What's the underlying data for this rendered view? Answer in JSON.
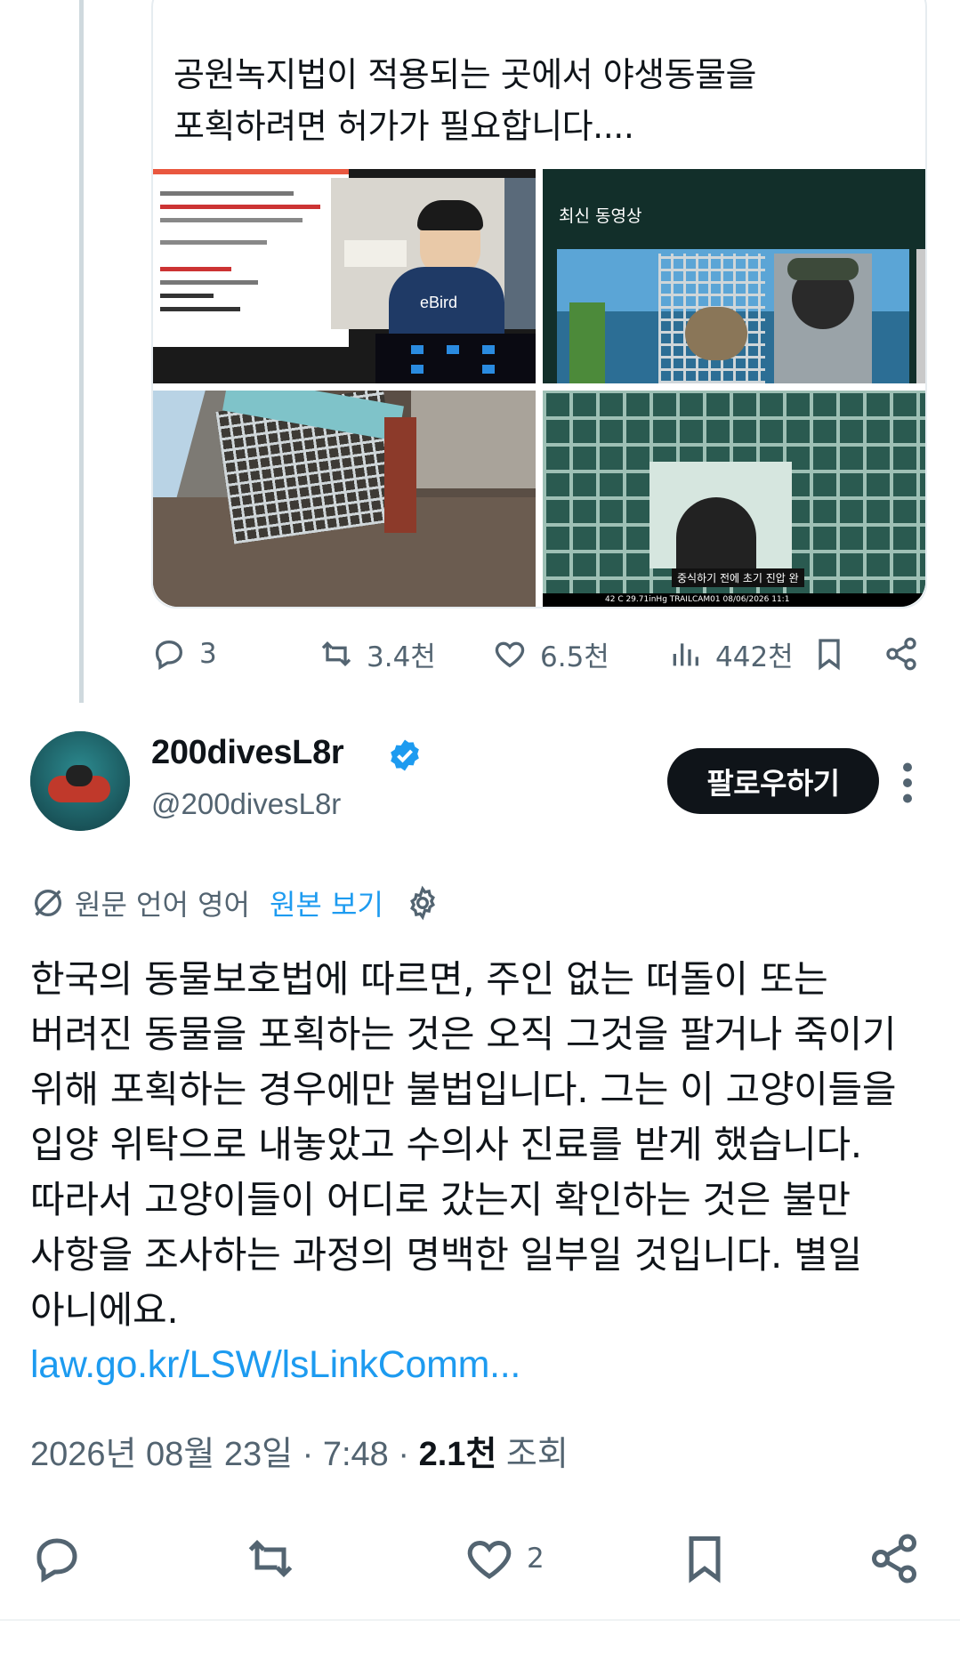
{
  "quoted": {
    "text_lines": [
      "공원녹지법이 적용되는 곳에서 야생동물을",
      "포획하려면 허가가 필요합니다...."
    ],
    "media": {
      "tile1_caption": "eBird",
      "tile2_title": "최신 동영상",
      "tile4_subtitle": "중식하기 전에 초기 진압 완",
      "tile4_info": "42 C  29.71inHg      TRAILCAM01      08/06/2026 11:1"
    },
    "actions": {
      "reply_count": "3",
      "retweet_count": "3.4천",
      "like_count": "6.5천",
      "views_count": "442천"
    }
  },
  "author": {
    "name": "200divesL8r",
    "handle": "@200divesL8r",
    "follow_label": "팔로우하기"
  },
  "translation": {
    "label": "원문 언어 영어",
    "view_original": "원본 보기"
  },
  "body": {
    "lines": [
      "한국의 동물보호법에 따르면, 주인 없는 떠돌이 또는",
      "버려진 동물을 포획하는 것은 오직 그것을 팔거나 죽이기",
      "위해 포획하는 경우에만 불법입니다. 그는 이 고양이들을",
      "입양 위탁으로 내놓았고 수의사 진료를 받게 했습니다.",
      "따라서 고양이들이 어디로 갔는지 확인하는 것은 불만",
      "사항을 조사하는 과정의 명백한 일부일 것입니다. 별일",
      "아니에요."
    ],
    "link": "law.go.kr/LSW/lsLinkComm..."
  },
  "meta": {
    "date": "2026년 08월 23일 · 7:48 · ",
    "views_number": "2.1천",
    "views_label": " 조회"
  },
  "bottom_actions": {
    "like_count": "2"
  },
  "colors": {
    "accent": "#1d9bf0",
    "text": "#0f1419",
    "muted": "#536471"
  }
}
